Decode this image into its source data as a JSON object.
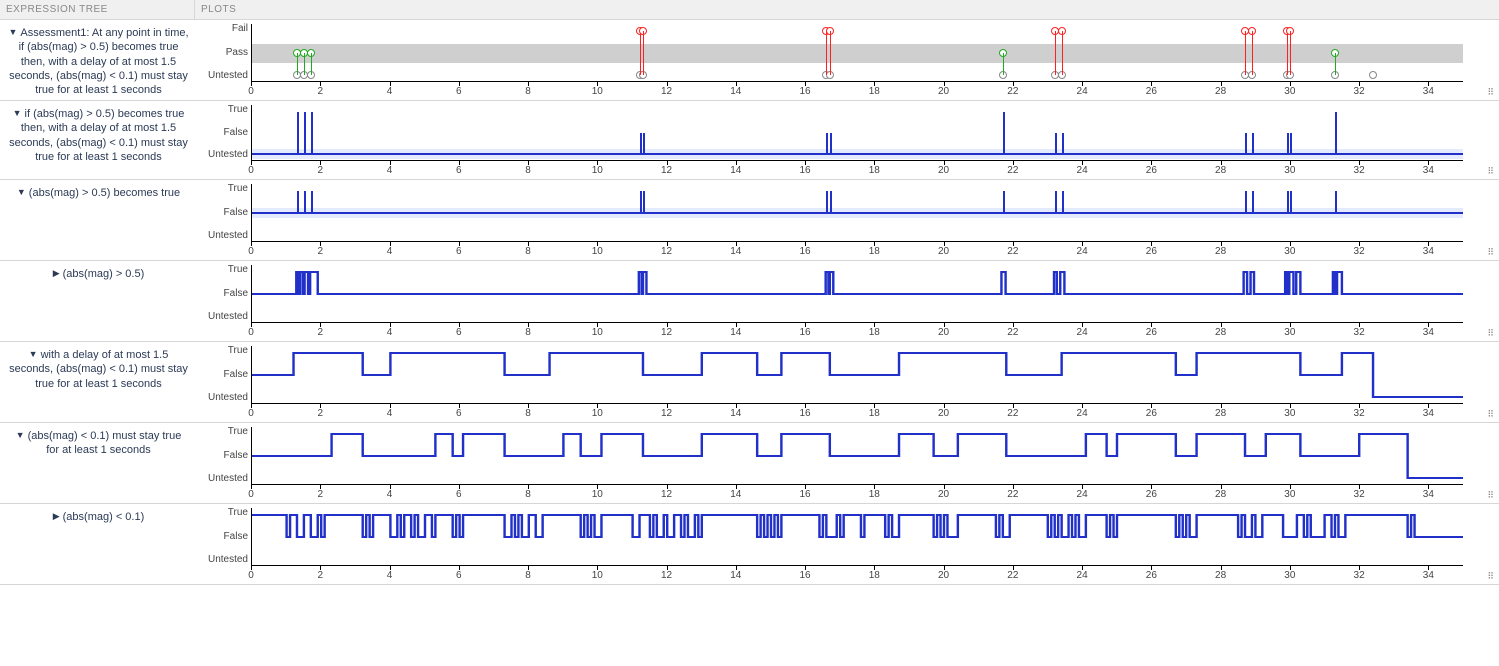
{
  "headers": {
    "tree": "EXPRESSION TREE",
    "plots": "PLOTS"
  },
  "xaxis": {
    "min": 0,
    "max": 35,
    "ticks": [
      0,
      2,
      4,
      6,
      8,
      10,
      12,
      14,
      16,
      18,
      20,
      22,
      24,
      26,
      28,
      30,
      32,
      34
    ]
  },
  "y_results": [
    "Fail",
    "Pass",
    "Untested"
  ],
  "y_bool": [
    "True",
    "False",
    "Untested"
  ],
  "rows": [
    {
      "id": "r1",
      "arrow": "down",
      "label": "Assessment1: At any point in time, if (abs(mag) > 0.5) becomes true then, with a delay of at most 1.5 seconds, (abs(mag) < 0.1) must stay true for at least 1 seconds",
      "type": "results",
      "height": 58,
      "chart_data": {
        "type": "event",
        "ylevels": [
          "Fail",
          "Pass",
          "Untested"
        ],
        "pass_band": true,
        "pass": [
          1.3,
          1.5,
          1.7,
          21.7,
          31.3
        ],
        "fail": [
          11.2,
          11.3,
          16.6,
          16.7,
          23.2,
          23.4,
          28.7,
          28.9,
          29.9,
          30.0
        ],
        "untested": [
          1.3,
          1.5,
          1.7,
          11.2,
          11.3,
          16.6,
          16.7,
          21.7,
          23.2,
          23.4,
          28.7,
          28.9,
          29.9,
          30.0,
          31.3,
          32.4
        ]
      }
    },
    {
      "id": "r2",
      "arrow": "down",
      "label": "if (abs(mag) > 0.5) becomes true then, with a delay of at most 1.5 seconds, (abs(mag) < 0.1) must stay true for at least 1 seconds",
      "type": "pulses",
      "height": 56,
      "chart_data": {
        "type": "pulse",
        "baseline": "Untested",
        "events": [
          {
            "t": 1.3,
            "v": "True"
          },
          {
            "t": 1.5,
            "v": "True"
          },
          {
            "t": 1.7,
            "v": "True"
          },
          {
            "t": 11.2,
            "v": "False"
          },
          {
            "t": 11.3,
            "v": "False"
          },
          {
            "t": 16.6,
            "v": "False"
          },
          {
            "t": 16.7,
            "v": "False"
          },
          {
            "t": 21.7,
            "v": "True"
          },
          {
            "t": 23.2,
            "v": "False"
          },
          {
            "t": 23.4,
            "v": "False"
          },
          {
            "t": 28.7,
            "v": "False"
          },
          {
            "t": 28.9,
            "v": "False"
          },
          {
            "t": 29.9,
            "v": "False"
          },
          {
            "t": 30.0,
            "v": "False"
          },
          {
            "t": 31.3,
            "v": "True"
          }
        ]
      }
    },
    {
      "id": "r3",
      "arrow": "down",
      "label": "(abs(mag) > 0.5) becomes true",
      "type": "pulses",
      "height": 58,
      "chart_data": {
        "type": "pulse",
        "baseline": "False",
        "events": [
          {
            "t": 1.3,
            "v": "True"
          },
          {
            "t": 1.5,
            "v": "True"
          },
          {
            "t": 1.7,
            "v": "True"
          },
          {
            "t": 11.2,
            "v": "True"
          },
          {
            "t": 11.3,
            "v": "True"
          },
          {
            "t": 16.6,
            "v": "True"
          },
          {
            "t": 16.7,
            "v": "True"
          },
          {
            "t": 21.7,
            "v": "True"
          },
          {
            "t": 23.2,
            "v": "True"
          },
          {
            "t": 23.4,
            "v": "True"
          },
          {
            "t": 28.7,
            "v": "True"
          },
          {
            "t": 28.9,
            "v": "True"
          },
          {
            "t": 29.9,
            "v": "True"
          },
          {
            "t": 30.0,
            "v": "True"
          },
          {
            "t": 31.3,
            "v": "True"
          }
        ]
      }
    },
    {
      "id": "r4",
      "arrow": "right",
      "label": "(abs(mag) > 0.5)",
      "type": "bool",
      "height": 58,
      "chart_data": {
        "type": "step",
        "init": "False",
        "transitions": [
          [
            1.28,
            "True"
          ],
          [
            1.34,
            "False"
          ],
          [
            1.4,
            "True"
          ],
          [
            1.48,
            "False"
          ],
          [
            1.52,
            "True"
          ],
          [
            1.62,
            "False"
          ],
          [
            1.68,
            "True"
          ],
          [
            1.9,
            "False"
          ],
          [
            11.18,
            "True"
          ],
          [
            11.26,
            "False"
          ],
          [
            11.3,
            "True"
          ],
          [
            11.4,
            "False"
          ],
          [
            16.58,
            "True"
          ],
          [
            16.66,
            "False"
          ],
          [
            16.7,
            "True"
          ],
          [
            16.8,
            "False"
          ],
          [
            21.66,
            "True"
          ],
          [
            21.78,
            "False"
          ],
          [
            23.18,
            "True"
          ],
          [
            23.26,
            "False"
          ],
          [
            23.36,
            "True"
          ],
          [
            23.48,
            "False"
          ],
          [
            28.66,
            "True"
          ],
          [
            28.76,
            "False"
          ],
          [
            28.86,
            "True"
          ],
          [
            28.96,
            "False"
          ],
          [
            29.86,
            "True"
          ],
          [
            29.92,
            "False"
          ],
          [
            29.98,
            "True"
          ],
          [
            30.1,
            "False"
          ],
          [
            30.18,
            "True"
          ],
          [
            30.3,
            "False"
          ],
          [
            31.24,
            "True"
          ],
          [
            31.3,
            "False"
          ],
          [
            31.36,
            "True"
          ],
          [
            31.5,
            "False"
          ]
        ]
      }
    },
    {
      "id": "r5",
      "arrow": "down",
      "label": "with a delay of at most 1.5 seconds, (abs(mag) < 0.1) must stay true for at least 1 seconds",
      "type": "bool",
      "height": 58,
      "chart_data": {
        "type": "step",
        "init": "False",
        "transitions": [
          [
            1.2,
            "True"
          ],
          [
            3.2,
            "False"
          ],
          [
            4.0,
            "True"
          ],
          [
            7.3,
            "False"
          ],
          [
            8.6,
            "True"
          ],
          [
            11.3,
            "False"
          ],
          [
            13.0,
            "True"
          ],
          [
            14.6,
            "False"
          ],
          [
            15.3,
            "True"
          ],
          [
            16.7,
            "False"
          ],
          [
            18.7,
            "True"
          ],
          [
            21.8,
            "False"
          ],
          [
            23.4,
            "True"
          ],
          [
            26.7,
            "False"
          ],
          [
            27.3,
            "True"
          ],
          [
            30.3,
            "False"
          ],
          [
            31.5,
            "True"
          ],
          [
            32.4,
            "Untested"
          ]
        ]
      }
    },
    {
      "id": "r6",
      "arrow": "down",
      "label": "(abs(mag) < 0.1) must stay true for at least 1 seconds",
      "type": "bool",
      "height": 58,
      "chart_data": {
        "type": "step",
        "init": "False",
        "transitions": [
          [
            2.3,
            "True"
          ],
          [
            3.2,
            "False"
          ],
          [
            5.3,
            "True"
          ],
          [
            5.8,
            "False"
          ],
          [
            6.1,
            "True"
          ],
          [
            7.3,
            "False"
          ],
          [
            9.0,
            "True"
          ],
          [
            9.5,
            "False"
          ],
          [
            10.1,
            "True"
          ],
          [
            11.3,
            "False"
          ],
          [
            13.0,
            "True"
          ],
          [
            14.6,
            "False"
          ],
          [
            15.3,
            "True"
          ],
          [
            16.7,
            "False"
          ],
          [
            18.7,
            "True"
          ],
          [
            19.7,
            "False"
          ],
          [
            20.4,
            "True"
          ],
          [
            21.8,
            "False"
          ],
          [
            24.1,
            "True"
          ],
          [
            24.7,
            "False"
          ],
          [
            25.0,
            "True"
          ],
          [
            26.7,
            "False"
          ],
          [
            27.3,
            "True"
          ],
          [
            28.7,
            "False"
          ],
          [
            29.3,
            "True"
          ],
          [
            30.3,
            "False"
          ],
          [
            32.0,
            "True"
          ],
          [
            33.4,
            "Untested"
          ]
        ]
      }
    },
    {
      "id": "r7",
      "arrow": "right",
      "label": "(abs(mag) < 0.1)",
      "type": "bool",
      "height": 58,
      "chart_data": {
        "type": "step",
        "init": "True",
        "transitions": [
          [
            1.0,
            "False"
          ],
          [
            1.1,
            "True"
          ],
          [
            1.3,
            "False"
          ],
          [
            1.5,
            "True"
          ],
          [
            1.7,
            "False"
          ],
          [
            1.9,
            "True"
          ],
          [
            2.0,
            "False"
          ],
          [
            2.1,
            "True"
          ],
          [
            3.2,
            "False"
          ],
          [
            3.3,
            "True"
          ],
          [
            3.4,
            "False"
          ],
          [
            3.5,
            "True"
          ],
          [
            4.0,
            "False"
          ],
          [
            4.2,
            "True"
          ],
          [
            4.3,
            "False"
          ],
          [
            4.4,
            "True"
          ],
          [
            4.6,
            "False"
          ],
          [
            4.7,
            "True"
          ],
          [
            4.8,
            "False"
          ],
          [
            5.0,
            "True"
          ],
          [
            5.2,
            "False"
          ],
          [
            5.3,
            "True"
          ],
          [
            5.8,
            "False"
          ],
          [
            5.9,
            "True"
          ],
          [
            6.0,
            "False"
          ],
          [
            6.1,
            "True"
          ],
          [
            7.3,
            "False"
          ],
          [
            7.5,
            "True"
          ],
          [
            7.6,
            "False"
          ],
          [
            7.7,
            "True"
          ],
          [
            7.8,
            "False"
          ],
          [
            8.0,
            "True"
          ],
          [
            8.2,
            "False"
          ],
          [
            8.4,
            "True"
          ],
          [
            9.5,
            "False"
          ],
          [
            9.6,
            "True"
          ],
          [
            9.7,
            "False"
          ],
          [
            9.8,
            "True"
          ],
          [
            9.9,
            "False"
          ],
          [
            10.1,
            "True"
          ],
          [
            11.0,
            "False"
          ],
          [
            11.2,
            "True"
          ],
          [
            11.5,
            "False"
          ],
          [
            11.6,
            "True"
          ],
          [
            11.7,
            "False"
          ],
          [
            11.9,
            "True"
          ],
          [
            12.0,
            "False"
          ],
          [
            12.2,
            "True"
          ],
          [
            12.4,
            "False"
          ],
          [
            12.5,
            "True"
          ],
          [
            12.6,
            "False"
          ],
          [
            12.8,
            "True"
          ],
          [
            12.9,
            "False"
          ],
          [
            13.0,
            "True"
          ],
          [
            14.6,
            "False"
          ],
          [
            14.7,
            "True"
          ],
          [
            14.8,
            "False"
          ],
          [
            14.9,
            "True"
          ],
          [
            15.0,
            "False"
          ],
          [
            15.1,
            "True"
          ],
          [
            15.2,
            "False"
          ],
          [
            15.3,
            "True"
          ],
          [
            16.4,
            "False"
          ],
          [
            16.5,
            "True"
          ],
          [
            16.6,
            "False"
          ],
          [
            16.9,
            "True"
          ],
          [
            17.0,
            "False"
          ],
          [
            17.1,
            "True"
          ],
          [
            17.6,
            "False"
          ],
          [
            17.7,
            "True"
          ],
          [
            18.3,
            "False"
          ],
          [
            18.4,
            "True"
          ],
          [
            18.5,
            "False"
          ],
          [
            18.7,
            "True"
          ],
          [
            19.7,
            "False"
          ],
          [
            19.8,
            "True"
          ],
          [
            19.9,
            "False"
          ],
          [
            20.0,
            "True"
          ],
          [
            20.1,
            "False"
          ],
          [
            20.4,
            "True"
          ],
          [
            21.5,
            "False"
          ],
          [
            21.6,
            "True"
          ],
          [
            21.7,
            "False"
          ],
          [
            21.9,
            "True"
          ],
          [
            23.0,
            "False"
          ],
          [
            23.1,
            "True"
          ],
          [
            23.2,
            "False"
          ],
          [
            23.3,
            "True"
          ],
          [
            23.4,
            "False"
          ],
          [
            23.6,
            "True"
          ],
          [
            23.7,
            "False"
          ],
          [
            23.8,
            "True"
          ],
          [
            23.9,
            "False"
          ],
          [
            24.1,
            "True"
          ],
          [
            24.7,
            "False"
          ],
          [
            24.8,
            "True"
          ],
          [
            24.9,
            "False"
          ],
          [
            25.0,
            "True"
          ],
          [
            26.7,
            "False"
          ],
          [
            26.8,
            "True"
          ],
          [
            26.9,
            "False"
          ],
          [
            27.0,
            "True"
          ],
          [
            27.1,
            "False"
          ],
          [
            27.3,
            "True"
          ],
          [
            28.5,
            "False"
          ],
          [
            28.6,
            "True"
          ],
          [
            28.7,
            "False"
          ],
          [
            28.9,
            "True"
          ],
          [
            29.0,
            "False"
          ],
          [
            29.2,
            "True"
          ],
          [
            29.8,
            "False"
          ],
          [
            30.2,
            "True"
          ],
          [
            30.4,
            "False"
          ],
          [
            30.5,
            "True"
          ],
          [
            30.6,
            "False"
          ],
          [
            31.0,
            "True"
          ],
          [
            31.2,
            "False"
          ],
          [
            31.3,
            "True"
          ],
          [
            31.4,
            "False"
          ],
          [
            31.6,
            "True"
          ],
          [
            33.4,
            "False"
          ],
          [
            33.5,
            "True"
          ],
          [
            33.6,
            "False"
          ]
        ]
      }
    }
  ]
}
